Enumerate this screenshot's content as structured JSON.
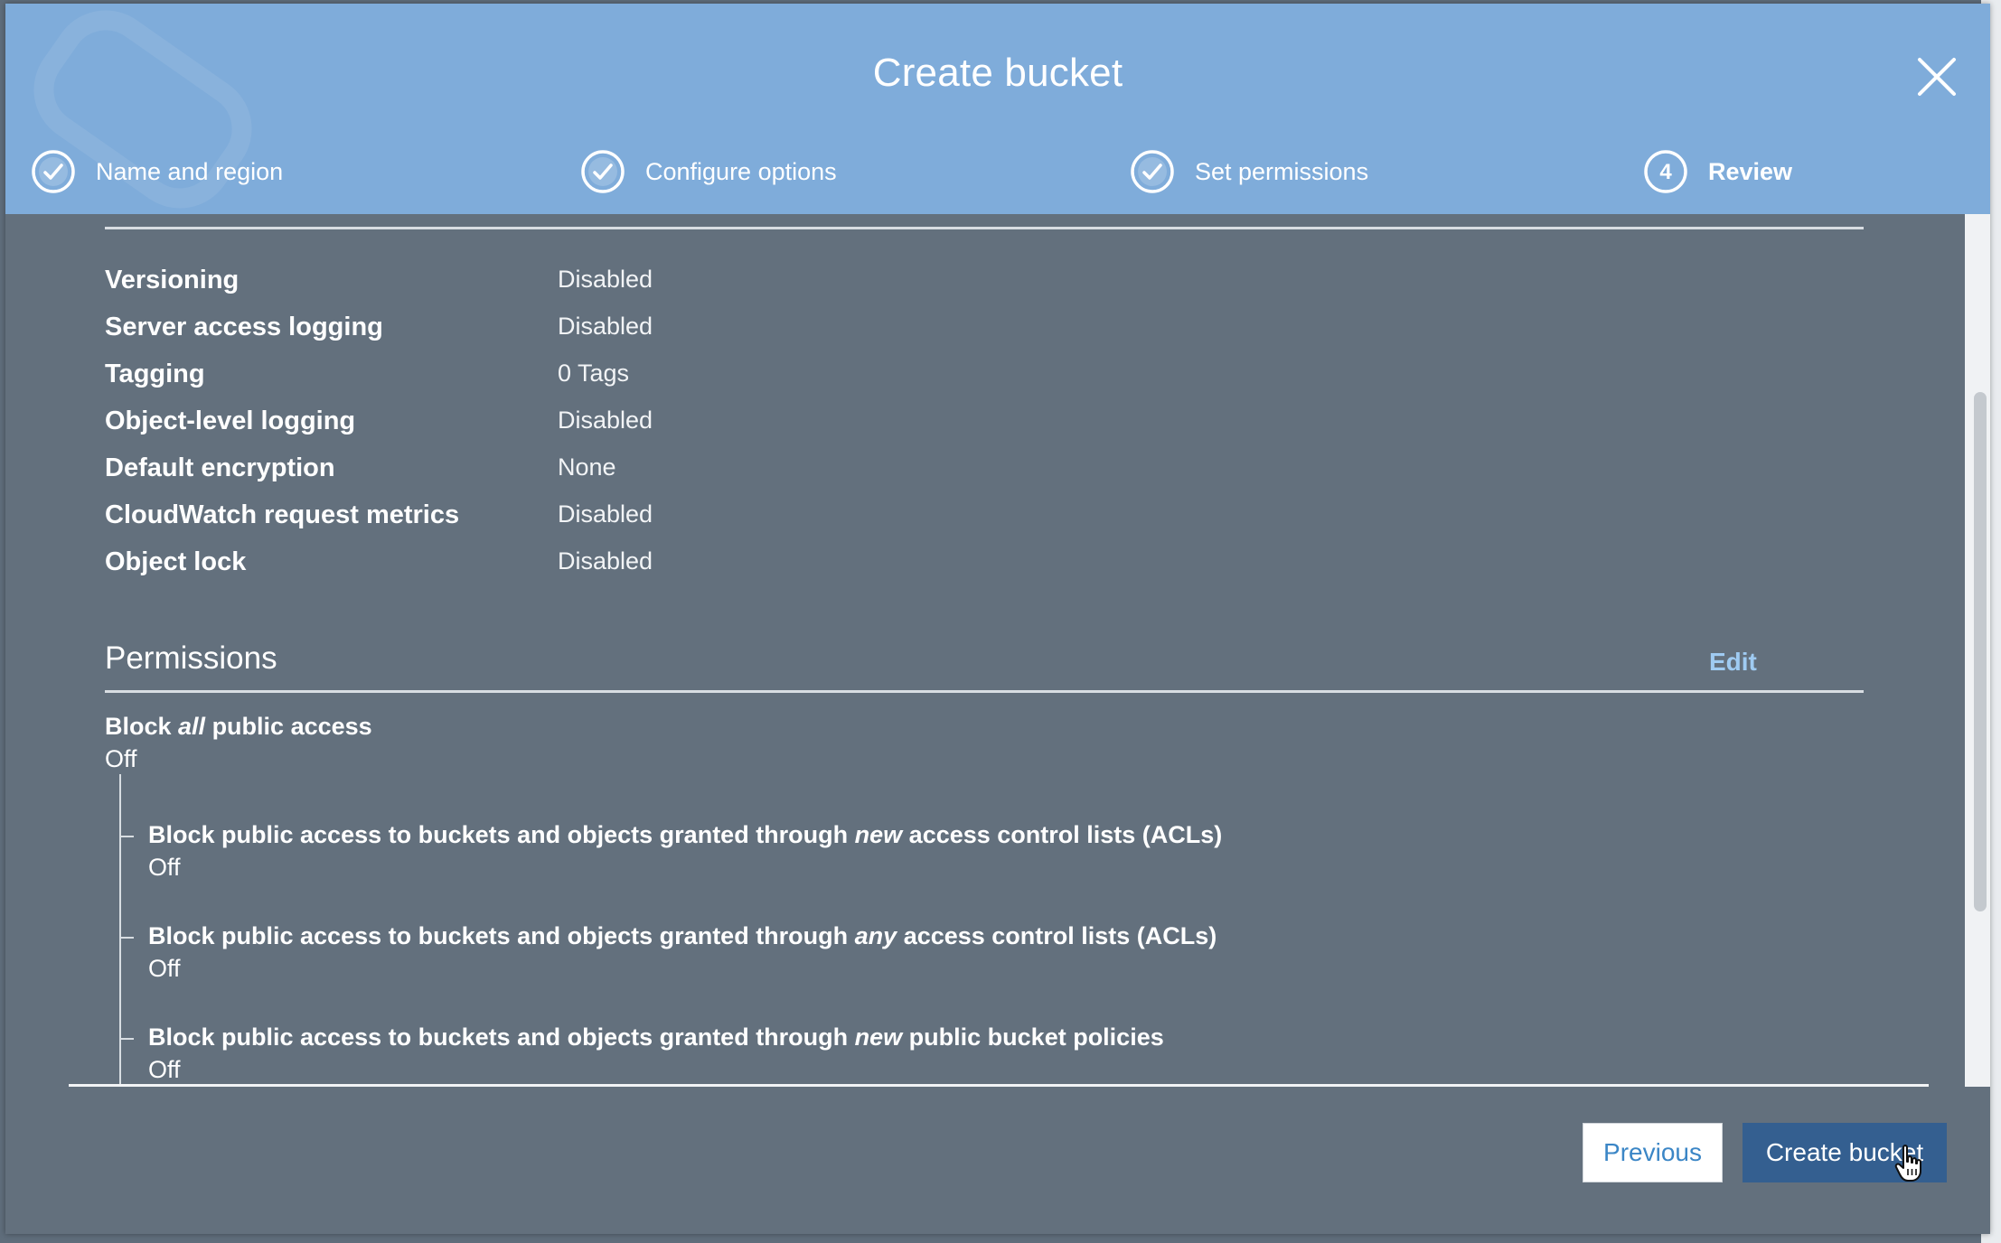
{
  "modal": {
    "title": "Create bucket",
    "close_icon": "close-icon"
  },
  "steps": [
    {
      "label": "Name and region",
      "state": "complete",
      "icon": "check-circle-icon"
    },
    {
      "label": "Configure options",
      "state": "complete",
      "icon": "check-circle-icon"
    },
    {
      "label": "Set permissions",
      "state": "complete",
      "icon": "check-circle-icon"
    },
    {
      "label": "Review",
      "state": "current",
      "number": "4",
      "icon": "step-number-icon"
    }
  ],
  "properties": [
    {
      "label": "Versioning",
      "value": "Disabled"
    },
    {
      "label": "Server access logging",
      "value": "Disabled"
    },
    {
      "label": "Tagging",
      "value": "0 Tags"
    },
    {
      "label": "Object-level logging",
      "value": "Disabled"
    },
    {
      "label": "Default encryption",
      "value": "None"
    },
    {
      "label": "CloudWatch request metrics",
      "value": "Disabled"
    },
    {
      "label": "Object lock",
      "value": "Disabled"
    }
  ],
  "permissions": {
    "title": "Permissions",
    "edit_label": "Edit",
    "block_all": {
      "prefix": "Block ",
      "emphasis": "all",
      "suffix": " public access",
      "value": "Off"
    },
    "items": [
      {
        "prefix": "Block public access to buckets and objects granted through ",
        "emphasis": "new",
        "suffix": " access control lists (ACLs)",
        "value": "Off"
      },
      {
        "prefix": "Block public access to buckets and objects granted through ",
        "emphasis": "any",
        "suffix": " access control lists (ACLs)",
        "value": "Off"
      },
      {
        "prefix": "Block public access to buckets and objects granted through ",
        "emphasis": "new",
        "suffix": " public bucket policies",
        "value": "Off"
      }
    ]
  },
  "footer": {
    "previous_label": "Previous",
    "create_label": "Create bucket"
  },
  "colors": {
    "header_bg": "#7facda",
    "body_bg": "#63707d",
    "primary_button": "#345f90",
    "link": "#9fcbf2"
  }
}
